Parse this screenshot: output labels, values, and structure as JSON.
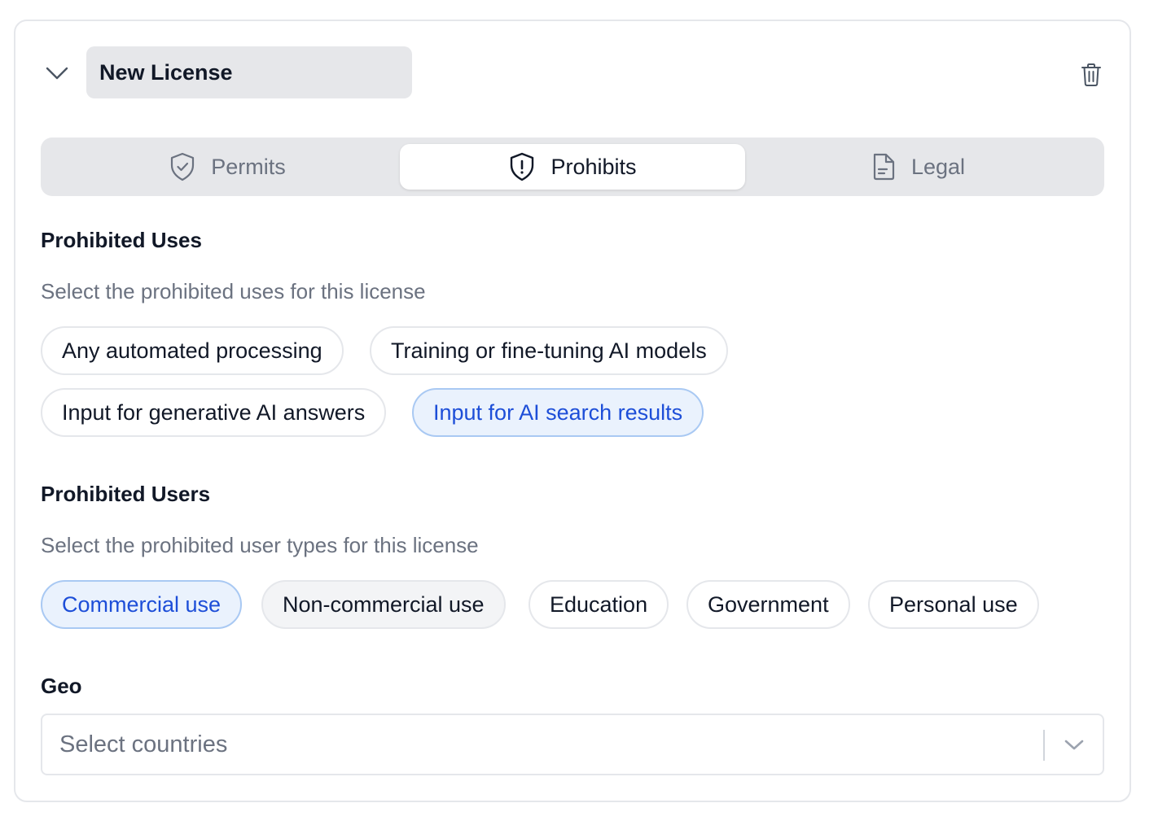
{
  "license": {
    "title": "New License"
  },
  "tabs": [
    {
      "label": "Permits",
      "icon": "shield-check-icon",
      "active": false
    },
    {
      "label": "Prohibits",
      "icon": "shield-alert-icon",
      "active": true
    },
    {
      "label": "Legal",
      "icon": "document-icon",
      "active": false
    }
  ],
  "prohibited_uses": {
    "title": "Prohibited Uses",
    "description": "Select the prohibited uses for this license",
    "options": [
      {
        "label": "Any automated processing",
        "selected": false
      },
      {
        "label": "Training or fine-tuning AI models",
        "selected": false
      },
      {
        "label": "Input for generative AI answers",
        "selected": false
      },
      {
        "label": "Input for AI search results",
        "selected": true
      }
    ]
  },
  "prohibited_users": {
    "title": "Prohibited Users",
    "description": "Select the prohibited user types for this license",
    "options": [
      {
        "label": "Commercial use",
        "selected": true
      },
      {
        "label": "Non-commercial use",
        "selected": false
      },
      {
        "label": "Education",
        "selected": false
      },
      {
        "label": "Government",
        "selected": false
      },
      {
        "label": "Personal use",
        "selected": false
      }
    ]
  },
  "geo": {
    "title": "Geo",
    "placeholder": "Select countries"
  },
  "colors": {
    "accent": "#1d4ed8",
    "selected_bg": "#eaf2fd",
    "selected_border": "#a9c9f3",
    "tab_bg": "#e6e7ea",
    "muted_text": "#6b7280"
  }
}
